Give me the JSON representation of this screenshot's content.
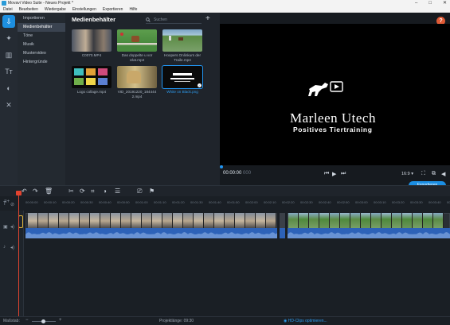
{
  "window": {
    "title": "Movavi Video Suite - Neues Projekt *",
    "controls": [
      "–",
      "□",
      "✕"
    ]
  },
  "menu": [
    "Datei",
    "Bearbeiten",
    "Wiedergabe",
    "Einstellungen",
    "Exportieren",
    "Hilfe"
  ],
  "left_icons": [
    {
      "name": "import-icon",
      "glyph": "⇩"
    },
    {
      "name": "effects-icon",
      "glyph": "✦"
    },
    {
      "name": "transitions-icon",
      "glyph": "▥"
    },
    {
      "name": "titles-icon",
      "glyph": "Tт"
    },
    {
      "name": "filters-icon",
      "glyph": "◐"
    },
    {
      "name": "tools-icon",
      "glyph": "✕"
    }
  ],
  "categories": [
    "Importieren",
    "Medienbehälter",
    "Töne",
    "Musik",
    "Mustervideo",
    "Hintergründe"
  ],
  "media_bin": {
    "title": "Medienbehälter",
    "search_placeholder": "Suchen",
    "add_glyph": "+",
    "items": [
      {
        "label": "C0070.MP4",
        "colors": [
          "#586070",
          "#c9b7a3",
          "#3c3d40"
        ]
      },
      {
        "label": "Das doppelte u vor Ulat.mp4",
        "colors": [
          "#4a8b3f",
          "#d6d2c6",
          "#c33"
        ]
      },
      {
        "label": "Hoopers Onlinkurs der Traile.mp4",
        "colors": [
          "#5b8c46",
          "#9fc18d",
          "#7aa06a"
        ]
      },
      {
        "label": "Logo collage.mp4",
        "colors": [
          "#0a0a0a",
          "#3fbfbd",
          "#e2a137"
        ]
      },
      {
        "label": "VID_20191220_184444 2.mp4",
        "colors": [
          "#93804d",
          "#d4c08a",
          "#6f6040"
        ]
      },
      {
        "label": "White on Black.png",
        "colors": [
          "#0a0a0a",
          "#ffffff",
          "#0a0a0a"
        ]
      }
    ]
  },
  "preview": {
    "title": "Marleen Utech",
    "subtitle": "Positives Tiertraining",
    "time_current": "00:00:00",
    "time_frames": "000",
    "aspect": "16:9 ▾",
    "help": "?"
  },
  "toolbar": {
    "export": "Exportieren"
  },
  "ruler": [
    "00:00:00",
    "00:00:10",
    "00:00:20",
    "00:00:30",
    "00:00:40",
    "00:00:50",
    "00:01:00",
    "00:01:10",
    "00:01:20",
    "00:01:30",
    "00:01:40",
    "00:01:50",
    "00:02:00",
    "00:02:10",
    "00:02:20",
    "00:02:30",
    "00:02:40",
    "00:02:50",
    "00:03:00",
    "00:03:10",
    "00:03:20",
    "00:03:30",
    "00:03:40",
    "00:03:50"
  ],
  "status": {
    "scale_label": "Maßstab:",
    "project_length": "Projektlänge:  09:30",
    "optimize": "HD-Clips optimieren..."
  }
}
